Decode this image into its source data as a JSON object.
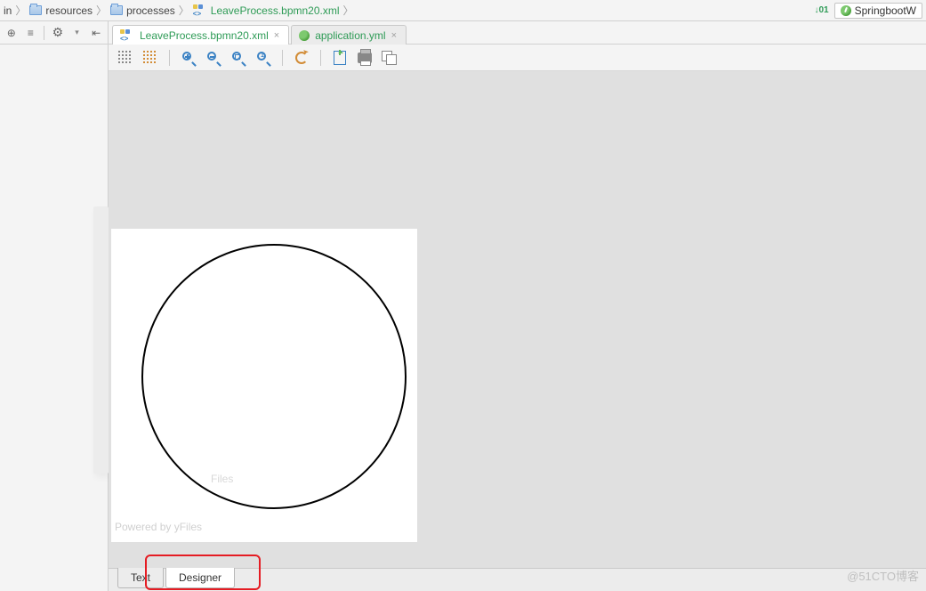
{
  "breadcrumb": {
    "seg0": "in",
    "seg1": "resources",
    "seg2": "processes",
    "seg3": "LeaveProcess.bpmn20.xml"
  },
  "run_config": {
    "binary_label": "01\n10",
    "name": "SpringbootW"
  },
  "gutter_tools": {
    "t0": "⊕",
    "t1": "≡",
    "t2": "⚙",
    "t3": "▾",
    "t4": "⇤"
  },
  "editor_tabs": {
    "tab0": "LeaveProcess.bpmn20.xml",
    "tab1": "application.yml"
  },
  "designer_toolbar": {
    "grid": "grid",
    "grid_sel": "grid-sel",
    "zoom_in": "zoom-in",
    "zoom_out": "zoom-out",
    "zoom_fit": "zoom-fit",
    "zoom_one": "zoom-1:1",
    "refresh": "refresh",
    "export": "export",
    "print": "print",
    "arrange": "arrange"
  },
  "canvas": {
    "watermark_small": "Files",
    "watermark": "Powered by yFiles"
  },
  "bottom_tabs": {
    "text": "Text",
    "designer": "Designer"
  },
  "page_watermark": "@51CTO博客"
}
